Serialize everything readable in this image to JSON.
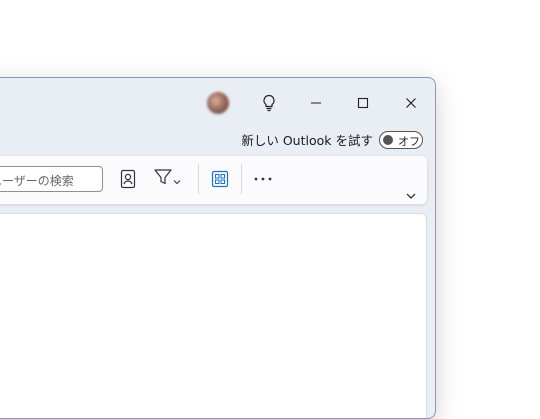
{
  "window": {
    "try_new_outlook": "新しい Outlook を試す",
    "toggle_state": "オフ"
  },
  "toolbar": {
    "search_placeholder": "ユーザーの検索"
  },
  "icons": [
    "avatar",
    "lightbulb-icon",
    "minimize-icon",
    "maximize-icon",
    "close-icon",
    "contact-card-icon",
    "filter-icon",
    "chevron-down-icon",
    "grid-view-icon",
    "more-icon",
    "expand-chevron-icon"
  ],
  "colors": {
    "window_bg": "#e9edf4",
    "window_border": "#7f9cc6",
    "grid_icon_accent": "#1a73c9"
  }
}
